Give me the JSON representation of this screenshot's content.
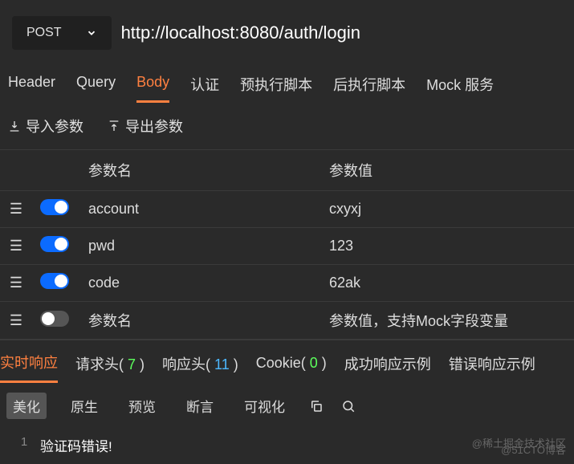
{
  "request": {
    "method": "POST",
    "url": "http://localhost:8080/auth/login"
  },
  "tabs": [
    "Header",
    "Query",
    "Body",
    "认证",
    "预执行脚本",
    "后执行脚本",
    "Mock 服务"
  ],
  "active_tab": "Body",
  "sub_actions": {
    "import": "导入参数",
    "export": "导出参数"
  },
  "param_table": {
    "headers": {
      "name": "参数名",
      "value": "参数值"
    },
    "rows": [
      {
        "enabled": true,
        "name": "account",
        "value": "cxyxj"
      },
      {
        "enabled": true,
        "name": "pwd",
        "value": "123"
      },
      {
        "enabled": true,
        "name": "code",
        "value": "62ak"
      }
    ],
    "placeholder_row": {
      "enabled": false,
      "name_placeholder": "参数名",
      "value_placeholder": "参数值，支持Mock字段变量"
    }
  },
  "response_tabs": [
    {
      "label": "实时响应",
      "count": null,
      "active": true
    },
    {
      "label": "请求头",
      "count": "7",
      "count_class": "count-green"
    },
    {
      "label": "响应头",
      "count": "11",
      "count_class": "count-blue"
    },
    {
      "label": "Cookie",
      "count": "0",
      "count_class": "count-green"
    },
    {
      "label": "成功响应示例",
      "count": null
    },
    {
      "label": "错误响应示例",
      "count": null
    }
  ],
  "toolbar": [
    "美化",
    "原生",
    "预览",
    "断言",
    "可视化"
  ],
  "active_tool": "美化",
  "response": {
    "line": "1",
    "text": "验证码错误!"
  },
  "watermarks": {
    "top": "@稀土掘金技术社区",
    "bottom": "@51CTO博客"
  }
}
